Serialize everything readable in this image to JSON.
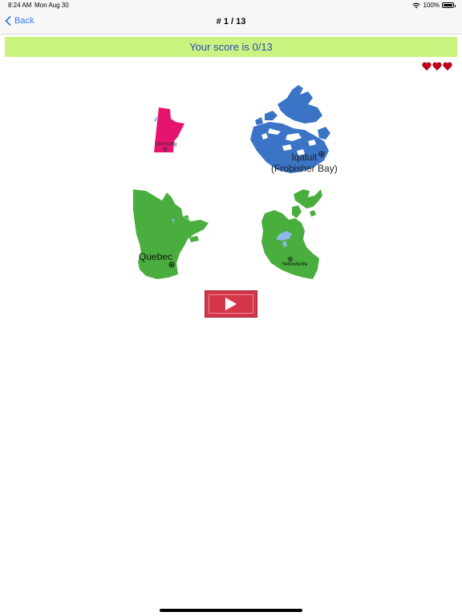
{
  "status_bar": {
    "time": "8:24 AM",
    "date": "Mon Aug 30",
    "battery": "100%"
  },
  "nav": {
    "back_label": "Back",
    "title": "# 1 / 13"
  },
  "score": {
    "text": "Your score is 0/13"
  },
  "lives": {
    "count": 3,
    "icon": "heart-icon",
    "color": "#d0021b"
  },
  "choices": [
    {
      "region": "Manitoba",
      "capital": "Winnipeg",
      "color": "#e5146e"
    },
    {
      "region": "Nunavut",
      "capital": "Iqaluit\n(Frobisher Bay)",
      "color": "#3b74c6"
    },
    {
      "region": "Quebec",
      "capital": "Quebec",
      "color": "#4aae3e"
    },
    {
      "region": "Northwest Territories",
      "capital": "Yellowknife",
      "color": "#4aae3e"
    }
  ],
  "play": {
    "icon": "play-icon",
    "color": "#d6364b"
  }
}
